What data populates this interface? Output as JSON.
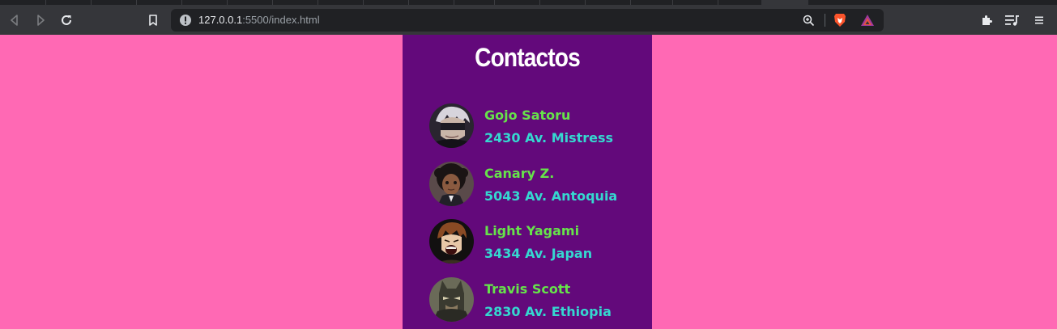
{
  "browser": {
    "url_host": "127.0.0.1",
    "url_rest": ":5500/index.html",
    "icons": [
      "back-icon",
      "forward-icon",
      "reload-icon",
      "bookmark-icon",
      "site-info-icon",
      "zoom-icon",
      "brave-shield-icon",
      "brave-rewards-icon",
      "extensions-icon",
      "playlist-icon",
      "menu-icon"
    ]
  },
  "page": {
    "title": "Contactos",
    "colors": {
      "background": "#ff69b4",
      "card": "#63097b",
      "name": "#66e34a",
      "address": "#35d8d0"
    },
    "contacts": [
      {
        "name": "Gojo Satoru",
        "address": "2430 Av. Mistress",
        "avatar": "gojo-avatar"
      },
      {
        "name": "Canary Z.",
        "address": "5043 Av. Antoquia",
        "avatar": "canary-avatar"
      },
      {
        "name": "Light Yagami",
        "address": "3434 Av. Japan",
        "avatar": "light-avatar"
      },
      {
        "name": "Travis Scott",
        "address": "2830 Av. Ethiopia",
        "avatar": "travis-avatar"
      }
    ]
  }
}
